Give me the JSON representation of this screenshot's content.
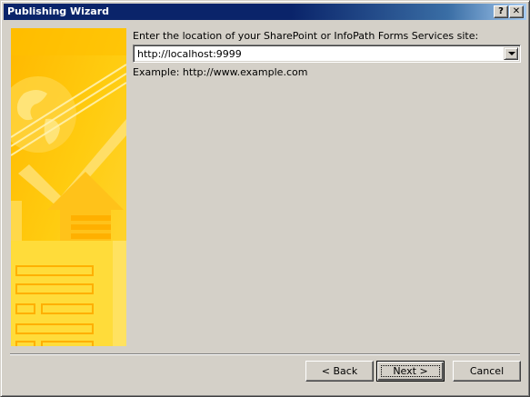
{
  "window": {
    "title": "Publishing Wizard",
    "help_glyph": "?",
    "close_glyph": "✕"
  },
  "main": {
    "prompt": "Enter the location of your SharePoint or InfoPath Forms Services site:",
    "location_value": "http://localhost:9999",
    "example": "Example: http://www.example.com"
  },
  "buttons": {
    "back": "< Back",
    "next": "Next >",
    "cancel": "Cancel"
  },
  "colors": {
    "dialog_bg": "#d4d0c8",
    "title_bar": "#0a246a",
    "side_art": "#ffcc00"
  },
  "icons": {
    "side_art": "wizard-illustration"
  }
}
